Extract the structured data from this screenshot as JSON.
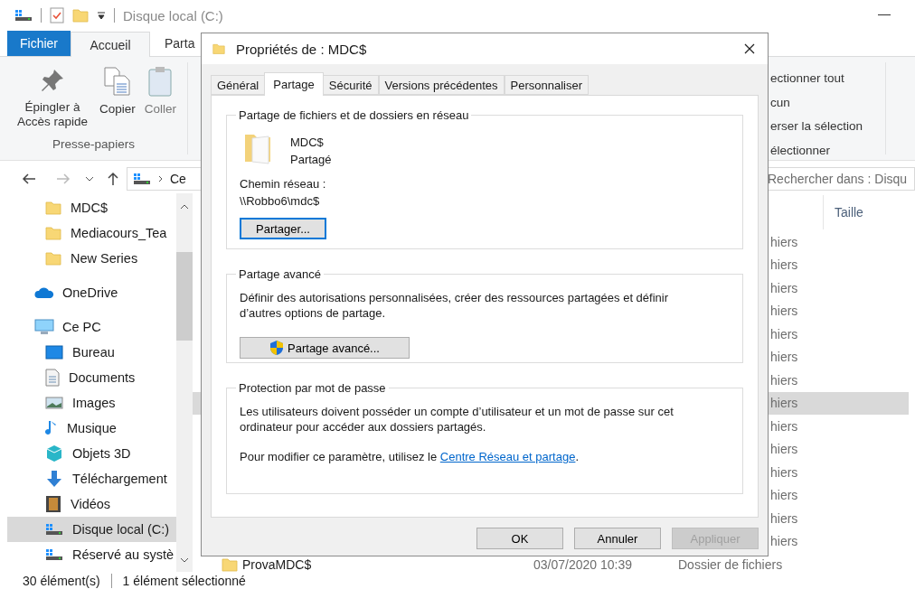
{
  "explorer": {
    "title": "Disque local (C:)",
    "ribbon_tabs": [
      {
        "label": "Fichier",
        "kind": "file",
        "selected": false
      },
      {
        "label": "Accueil",
        "kind": "tab",
        "selected": true
      },
      {
        "label": "Parta",
        "kind": "tab",
        "selected": false
      }
    ],
    "clipboard": {
      "buttons": [
        {
          "label": "Épingler à Accès rapide",
          "kind": "pin",
          "disabled": false
        },
        {
          "label": "Copier",
          "kind": "copy",
          "disabled": false
        },
        {
          "label": "Coller",
          "kind": "paste",
          "disabled": true
        }
      ],
      "group_label": "Presse-papiers"
    },
    "select_group": [
      "ectionner tout",
      "cun",
      "erser la sélection",
      "électionner"
    ],
    "address": {
      "crumb": "Ce"
    },
    "search": {
      "placeholder": "Rechercher dans : Disqu"
    },
    "nav": {
      "pinned": [
        {
          "label": "MDC$",
          "kind": "folder",
          "selected": false
        },
        {
          "label": "Mediacours_Tea",
          "kind": "folder",
          "selected": false
        },
        {
          "label": "New Series",
          "kind": "folder",
          "selected": false
        }
      ],
      "roots": [
        {
          "label": "OneDrive",
          "kind": "cloud",
          "selected": false
        },
        {
          "label": "Ce PC",
          "kind": "computer",
          "selected": false,
          "children": [
            {
              "label": "Bureau",
              "kind": "desktop",
              "selected": false
            },
            {
              "label": "Documents",
              "kind": "document",
              "selected": false
            },
            {
              "label": "Images",
              "kind": "picture",
              "selected": false
            },
            {
              "label": "Musique",
              "kind": "music",
              "selected": false
            },
            {
              "label": "Objets 3D",
              "kind": "cube",
              "selected": false
            },
            {
              "label": "Téléchargement",
              "kind": "download",
              "selected": false
            },
            {
              "label": "Vidéos",
              "kind": "film",
              "selected": false
            },
            {
              "label": "Disque local (C:)",
              "kind": "drive",
              "selected": true
            },
            {
              "label": "Réservé au systè",
              "kind": "drive",
              "selected": false
            }
          ]
        }
      ]
    },
    "columns": [
      {
        "label": "Taille"
      }
    ],
    "rows": [
      {
        "type": "hiers",
        "selected": false
      },
      {
        "type": "hiers",
        "selected": false
      },
      {
        "type": "hiers",
        "selected": false
      },
      {
        "type": "hiers",
        "selected": false
      },
      {
        "type": "hiers",
        "selected": false
      },
      {
        "type": "hiers",
        "selected": false
      },
      {
        "type": "hiers",
        "selected": false
      },
      {
        "type": "hiers",
        "selected": true
      },
      {
        "type": "hiers",
        "selected": false
      },
      {
        "type": "hiers",
        "selected": false
      },
      {
        "type": "hiers",
        "selected": false
      },
      {
        "type": "hiers",
        "selected": false
      },
      {
        "type": "hiers",
        "selected": false
      },
      {
        "type": "hiers",
        "selected": false
      },
      {
        "name": "ProvaMDC$",
        "date": "03/07/2020 10:39",
        "type": "Dossier de fichiers",
        "selected": false
      }
    ],
    "status": {
      "count": "30 élément(s)",
      "selection": "1 élément sélectionné"
    }
  },
  "dialog": {
    "title": "Propriétés de : MDC$",
    "tabs": [
      {
        "label": "Général",
        "selected": false
      },
      {
        "label": "Partage",
        "selected": true
      },
      {
        "label": "Sécurité",
        "selected": false
      },
      {
        "label": "Versions précédentes",
        "selected": false
      },
      {
        "label": "Personnaliser",
        "selected": false
      }
    ],
    "network_share": {
      "legend": "Partage de fichiers et de dossiers en réseau",
      "name": "MDC$",
      "status": "Partagé",
      "path_label": "Chemin réseau :",
      "path": "\\\\Robbo6\\mdc$",
      "button": "Partager..."
    },
    "advanced": {
      "legend": "Partage avancé",
      "description": "Définir des autorisations personnalisées, créer des ressources partagées et définir d’autres options de partage.",
      "button": "Partage avancé..."
    },
    "password": {
      "legend": "Protection par mot de passe",
      "description": "Les utilisateurs doivent posséder un compte d’utilisateur et un mot de passe sur cet ordinateur pour accéder aux dossiers partagés.",
      "hint": "Pour modifier ce paramètre, utilisez le ",
      "link": "Centre Réseau et partage",
      "hint_end": "."
    },
    "buttons": [
      {
        "label": "OK",
        "disabled": false
      },
      {
        "label": "Annuler",
        "disabled": false
      },
      {
        "label": "Appliquer",
        "disabled": true
      }
    ]
  }
}
